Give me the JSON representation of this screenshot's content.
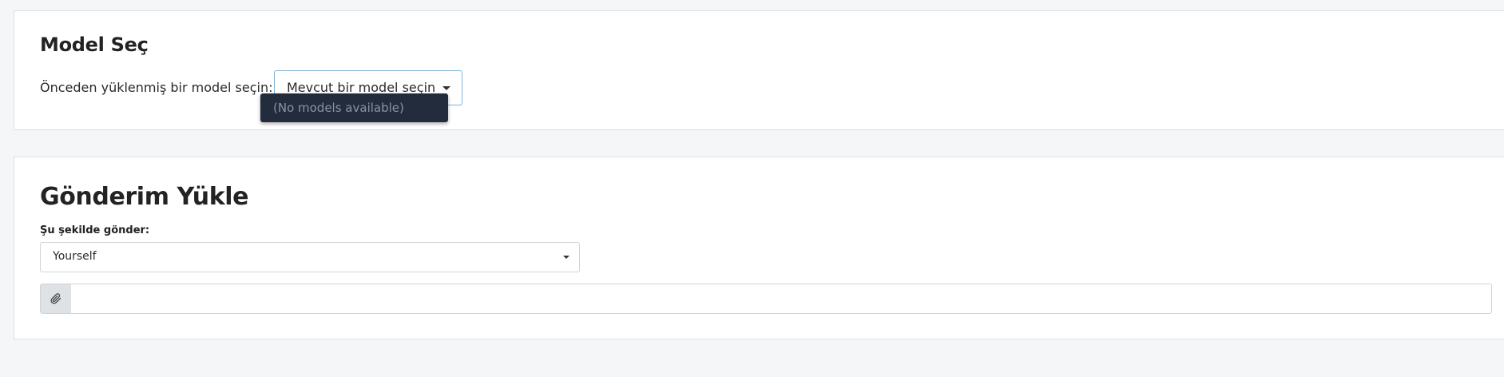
{
  "model_section": {
    "title": "Model Seç",
    "select_label": "Önceden yüklenmiş bir model seçin:",
    "dropdown": {
      "selected": "Mevcut bir model seçin",
      "options": [
        "(No models available)"
      ]
    }
  },
  "upload_section": {
    "title": "Gönderim Yükle",
    "send_as_label": "Şu şekilde gönder:",
    "send_as_value": "Yourself",
    "file_input": {
      "icon": "paperclip-icon",
      "value": ""
    }
  },
  "colors": {
    "background": "#f5f6f8",
    "card": "#ffffff",
    "dropdown_menu_bg": "#232c3d",
    "dropdown_focus_border": "#7fb2d8",
    "addon_bg": "#dfe2e5"
  }
}
